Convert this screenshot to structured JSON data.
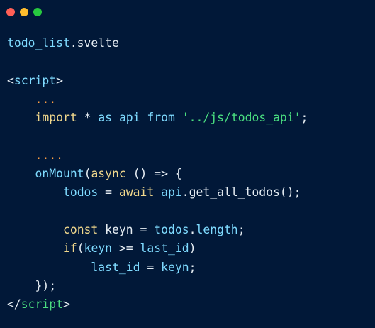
{
  "window": {
    "buttons": [
      {
        "name": "close",
        "color": "#ff5f56"
      },
      {
        "name": "minimize",
        "color": "#ffbd2e"
      },
      {
        "name": "maximize",
        "color": "#27c93f"
      }
    ]
  },
  "code": {
    "lines": [
      [
        {
          "t": "todo_list",
          "c": "cyan"
        },
        {
          "t": ".svelte",
          "c": "plain"
        }
      ],
      [],
      [
        {
          "t": "<",
          "c": "plain"
        },
        {
          "t": "script",
          "c": "cyan"
        },
        {
          "t": ">",
          "c": "plain"
        }
      ],
      [
        {
          "t": "    ",
          "c": "plain"
        },
        {
          "t": "...",
          "c": "orange"
        }
      ],
      [
        {
          "t": "    ",
          "c": "plain"
        },
        {
          "t": "import",
          "c": "yellow"
        },
        {
          "t": " * ",
          "c": "plain"
        },
        {
          "t": "as",
          "c": "cyan"
        },
        {
          "t": " ",
          "c": "plain"
        },
        {
          "t": "api",
          "c": "cyan"
        },
        {
          "t": " ",
          "c": "plain"
        },
        {
          "t": "from",
          "c": "cyan"
        },
        {
          "t": " ",
          "c": "plain"
        },
        {
          "t": "'../js/todos_api'",
          "c": "string"
        },
        {
          "t": ";",
          "c": "plain"
        }
      ],
      [],
      [
        {
          "t": "    ",
          "c": "plain"
        },
        {
          "t": "....",
          "c": "orange"
        }
      ],
      [
        {
          "t": "    ",
          "c": "plain"
        },
        {
          "t": "onMount",
          "c": "cyan"
        },
        {
          "t": "(",
          "c": "plain"
        },
        {
          "t": "async",
          "c": "yellow"
        },
        {
          "t": " () => {",
          "c": "plain"
        }
      ],
      [
        {
          "t": "        ",
          "c": "plain"
        },
        {
          "t": "todos",
          "c": "cyan"
        },
        {
          "t": " = ",
          "c": "plain"
        },
        {
          "t": "await",
          "c": "yellow"
        },
        {
          "t": " ",
          "c": "plain"
        },
        {
          "t": "api",
          "c": "cyan"
        },
        {
          "t": ".get_all_todos();",
          "c": "plain"
        }
      ],
      [],
      [
        {
          "t": "        ",
          "c": "plain"
        },
        {
          "t": "const",
          "c": "yellow"
        },
        {
          "t": " keyn = ",
          "c": "plain"
        },
        {
          "t": "todos",
          "c": "cyan"
        },
        {
          "t": ".",
          "c": "plain"
        },
        {
          "t": "length",
          "c": "cyan"
        },
        {
          "t": ";",
          "c": "plain"
        }
      ],
      [
        {
          "t": "        ",
          "c": "plain"
        },
        {
          "t": "if",
          "c": "yellow"
        },
        {
          "t": "(",
          "c": "plain"
        },
        {
          "t": "keyn",
          "c": "cyan"
        },
        {
          "t": " >= ",
          "c": "plain"
        },
        {
          "t": "last_id",
          "c": "cyan"
        },
        {
          "t": ")",
          "c": "plain"
        }
      ],
      [
        {
          "t": "            ",
          "c": "plain"
        },
        {
          "t": "last_id",
          "c": "cyan"
        },
        {
          "t": " = ",
          "c": "plain"
        },
        {
          "t": "keyn",
          "c": "cyan"
        },
        {
          "t": ";",
          "c": "plain"
        }
      ],
      [
        {
          "t": "    ",
          "c": "plain"
        },
        {
          "t": "});",
          "c": "plain"
        }
      ],
      [
        {
          "t": "</",
          "c": "plain"
        },
        {
          "t": "script",
          "c": "green"
        },
        {
          "t": ">",
          "c": "plain"
        }
      ]
    ]
  },
  "colors": {
    "background": "#011838",
    "plain": "#e6edf3",
    "cyan": "#7fdbff",
    "yellow": "#f0d78c",
    "orange": "#ff9f43",
    "green": "#4ade80",
    "string": "#4ade80"
  }
}
